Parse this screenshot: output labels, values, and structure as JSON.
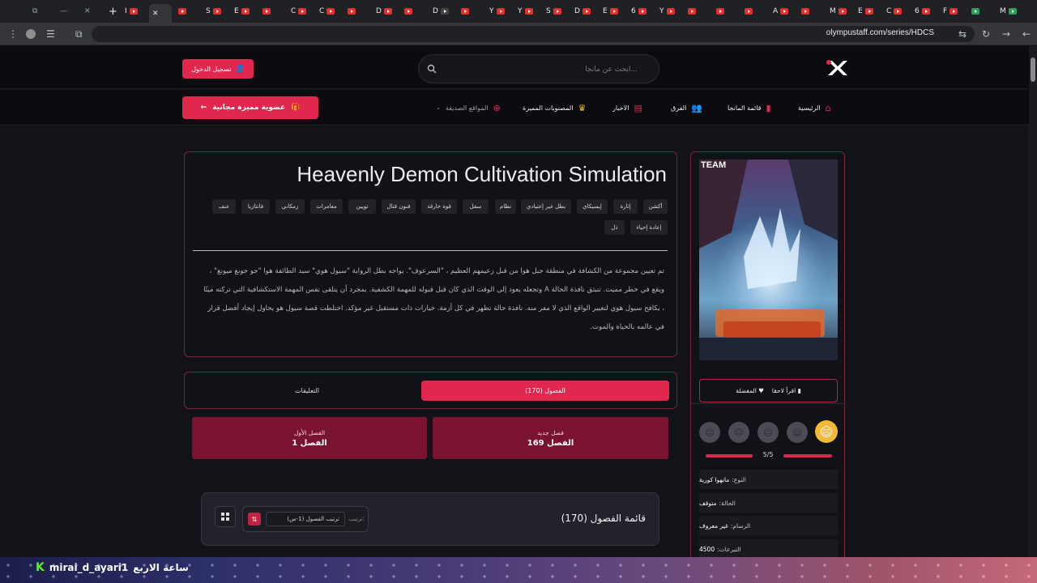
{
  "browser": {
    "url": "olympustaff.com/series/HDCS",
    "tab_labels": [
      "I",
      "E",
      "S",
      "E",
      "C",
      "C",
      "C",
      "C",
      "D",
      "D",
      "Y",
      "Y",
      "S",
      "D",
      "E",
      "Y",
      "6",
      "C",
      "C",
      "ي",
      "A",
      "M",
      "E",
      "C",
      "6",
      "F",
      "M"
    ]
  },
  "site": {
    "search_placeholder": "ابحث عن مانجا...",
    "login_label": "تسجيل الدخول",
    "premium_label": "عضوية مميزة مجانية",
    "nav": {
      "home": "الرئيسية",
      "manga_list": "قائمة المانجا",
      "teams": "الفرق",
      "news": "الاخبار",
      "premium_works": "المصنوبات المميزة",
      "friend_sites": "المواقع الصديقة"
    }
  },
  "series": {
    "title": "Heavenly Demon Cultivation Simulation",
    "genres_row1": [
      "أكشن",
      "إثارة",
      "إيسيكاي",
      "بطل غير إعتيادي",
      "نظام",
      "سقل",
      "قوة خارقة",
      "فنون قتال",
      "تويين",
      "مغامرات",
      "زمكاني",
      "فانتازيا",
      "عنف"
    ],
    "genres_row2": [
      "إعادة إحياء",
      "ذل"
    ],
    "description": "تم تعيين مجموعة من الكشافة في منطقة جبل هوا من قبل زعيمهم العظيم ، \"السرعوف\". يواجه بطل الرواية \"سيول هوي\" سيد الطائفة هوا \"جو جونغ ميونغ\" ، ويقع في خطر مميت. تنبثق نافذة الحالة A وتجعله يعود إلى الوقت الذي كان قبل قبوله للمهمة الكشفية. بمجرد أن يتلقى نفس المهمة الاستكشافية التي تركته ميتًا ، يكافح سيول هوي لتغيير الواقع الذي لا مفر منه. نافذة حالة تظهر في كل أزمة. خيارات ذات مستقبل غير مؤكد. اختلطت قصة سيول هو يحاول إيجاد أفضل قرار في عالمه بالحياة والموت.",
    "tab_chapters": "الفصول (170)",
    "tab_comments": "التعليقات",
    "new_chapter_label": "فصل جديد",
    "new_chapter_value": "الفصل 169",
    "first_chapter_label": "الفصل الأول",
    "first_chapter_value": "الفصل 1",
    "chapter_list_title": "قائمة الفصول (170)",
    "sort_label": "ترتيب:",
    "sort_value": "ترتيب الفصول (1-س)",
    "bookmark_label": "اقرأ لاحقا",
    "favorite_label": "المفضلة",
    "rating_text": "5/5",
    "rating_value": 5,
    "rating_max": 5,
    "info": {
      "type_key": "النوع:",
      "type_val": "مانهوا كورية",
      "status_key": "الحالة:",
      "status_val": "متوقف",
      "artist_key": "الرسام:",
      "artist_val": "غير معروف",
      "donations_key": "التبرعات:",
      "donations_val": "4500"
    },
    "cover_badge": "TEAM"
  },
  "stream": {
    "username": "mirai_d_ayari1",
    "caption": "ساعة الاربع"
  },
  "colors": {
    "accent": "#e0284f",
    "dark_accent": "#7a1330",
    "bg": "#121318"
  }
}
